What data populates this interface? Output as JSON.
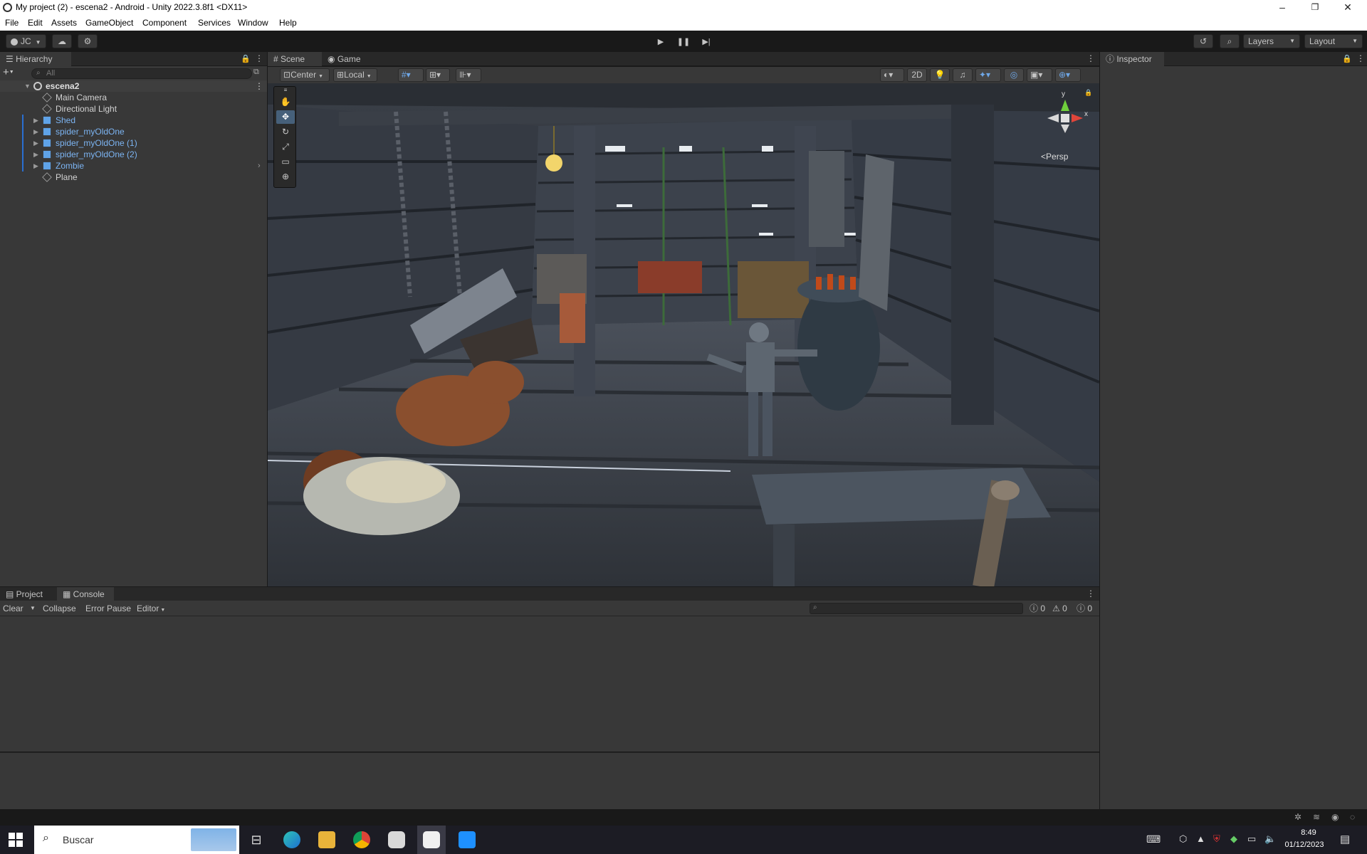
{
  "window": {
    "title": "My project (2) - escena2 - Android - Unity 2022.3.8f1 <DX11>",
    "minimize": "–",
    "maximize": "❐",
    "close": "✕"
  },
  "menu": [
    "File",
    "Edit",
    "Assets",
    "GameObject",
    "Component",
    "Services",
    "Window",
    "Help"
  ],
  "toolbar": {
    "account": "JC",
    "layers": "Layers",
    "layout": "Layout"
  },
  "hierarchy": {
    "tab": "Hierarchy",
    "search_placeholder": "All",
    "scene_name": "escena2",
    "items": [
      {
        "label": "Main Camera",
        "prefab": false
      },
      {
        "label": "Directional Light",
        "prefab": false
      },
      {
        "label": "Shed",
        "prefab": true
      },
      {
        "label": "spider_myOldOne",
        "prefab": true
      },
      {
        "label": "spider_myOldOne (1)",
        "prefab": true
      },
      {
        "label": "spider_myOldOne (2)",
        "prefab": true
      },
      {
        "label": "Zombie",
        "prefab": true
      },
      {
        "label": "Plane",
        "prefab": false
      }
    ]
  },
  "scene": {
    "tab_scene": "Scene",
    "tab_game": "Game",
    "pivot": "Center",
    "space": "Local",
    "mode_2d": "2D",
    "persp": "Persp",
    "gizmo_y": "y",
    "gizmo_x": "x"
  },
  "inspector": {
    "tab": "Inspector"
  },
  "console": {
    "tab_project": "Project",
    "tab_console": "Console",
    "clear": "Clear",
    "collapse": "Collapse",
    "error_pause": "Error Pause",
    "editor": "Editor",
    "count_log": "0",
    "count_warn": "0",
    "count_error": "0"
  },
  "taskbar": {
    "search_placeholder": "Buscar",
    "time": "8:49",
    "date": "01/12/2023"
  },
  "colors": {
    "prefab_blue": "#7cb4f2",
    "panel_bg": "#383838",
    "dark_bg": "#191919",
    "accent": "#2a6fd1"
  }
}
